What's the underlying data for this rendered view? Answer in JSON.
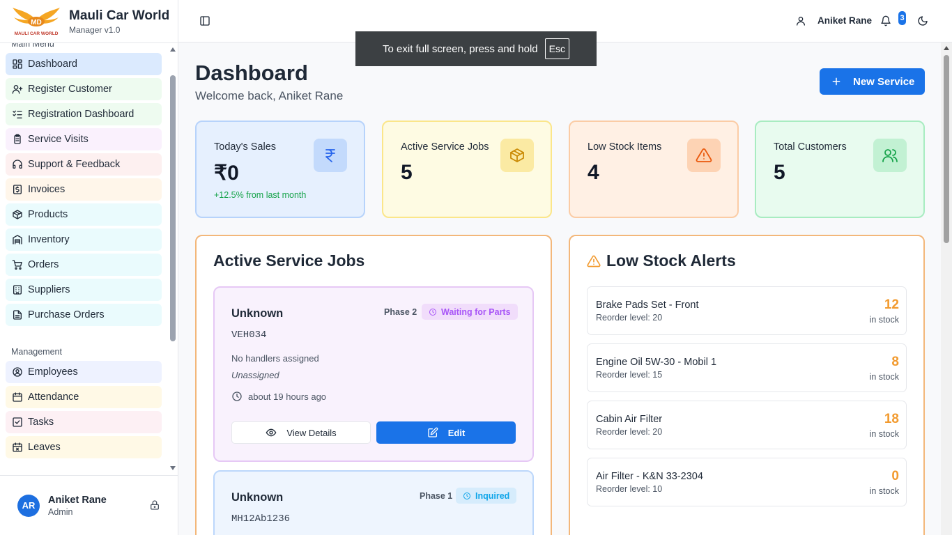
{
  "app": {
    "name": "Mauli Car World",
    "version": "Manager v1.0",
    "logo_text": "MAULI CAR WORLD"
  },
  "sidebar": {
    "main_menu_label": "Main Menu",
    "main_items": [
      {
        "label": "Dashboard",
        "icon": "layout-dashboard-icon",
        "bg": "#dbeafe",
        "active": true
      },
      {
        "label": "Register Customer",
        "icon": "user-plus-icon",
        "bg": "#eefbf0"
      },
      {
        "label": "Registration Dashboard",
        "icon": "list-checks-icon",
        "bg": "#eefbf0"
      },
      {
        "label": "Service Visits",
        "icon": "clipboard-icon",
        "bg": "#faf1fd"
      },
      {
        "label": "Support & Feedback",
        "icon": "headphones-icon",
        "bg": "#fdf0f0"
      },
      {
        "label": "Invoices",
        "icon": "receipt-icon",
        "bg": "#fff6ea"
      },
      {
        "label": "Products",
        "icon": "package-icon",
        "bg": "#eafbfd"
      },
      {
        "label": "Inventory",
        "icon": "warehouse-icon",
        "bg": "#eafbfd"
      },
      {
        "label": "Orders",
        "icon": "cart-icon",
        "bg": "#eafbfd"
      },
      {
        "label": "Suppliers",
        "icon": "building-icon",
        "bg": "#eafbfd"
      },
      {
        "label": "Purchase Orders",
        "icon": "file-icon",
        "bg": "#eafbfd"
      }
    ],
    "management_label": "Management",
    "management_items": [
      {
        "label": "Employees",
        "icon": "user-circle-icon",
        "bg": "#eef2ff"
      },
      {
        "label": "Attendance",
        "icon": "calendar-icon",
        "bg": "#fff9e6"
      },
      {
        "label": "Tasks",
        "icon": "check-square-icon",
        "bg": "#fdf0f4"
      },
      {
        "label": "Leaves",
        "icon": "calendar-x-icon",
        "bg": "#fff9e6"
      }
    ],
    "user": {
      "initials": "AR",
      "name": "Aniket Rane",
      "role": "Admin"
    }
  },
  "topbar": {
    "user_name": "Aniket Rane",
    "notification_count": "3"
  },
  "fullscreen_toast": {
    "text": "To exit full screen, press and hold",
    "key": "Esc"
  },
  "page": {
    "title": "Dashboard",
    "welcome": "Welcome back, Aniket Rane",
    "new_button": "New Service"
  },
  "stats": [
    {
      "label": "Today's Sales",
      "value": "₹0",
      "note": "+12.5% from last month",
      "icon": "rupee-icon",
      "bg": "#e6f0fe",
      "border": "#b7d3fb",
      "icon_bg": "#c3dafc",
      "icon_color": "#2563eb"
    },
    {
      "label": "Active Service Jobs",
      "value": "5",
      "note": "",
      "icon": "package-icon",
      "bg": "#fefbe3",
      "border": "#fbe68a",
      "icon_bg": "#fbeaa3",
      "icon_color": "#ca8a04"
    },
    {
      "label": "Low Stock Items",
      "value": "4",
      "note": "",
      "icon": "alert-triangle-icon",
      "bg": "#fff0e4",
      "border": "#fbcca5",
      "icon_bg": "#fdd3b4",
      "icon_color": "#ea580c"
    },
    {
      "label": "Total Customers",
      "value": "5",
      "note": "",
      "icon": "users-icon",
      "bg": "#e8fbef",
      "border": "#a8ecc1",
      "icon_bg": "#c2f1d3",
      "icon_color": "#16a34a"
    }
  ],
  "active_jobs": {
    "title": "Active Service Jobs",
    "jobs": [
      {
        "name": "Unknown",
        "phase": "Phase 2",
        "status": "Waiting for Parts",
        "vehicle": "VEH034",
        "handlers": "No handlers assigned",
        "assignee": "Unassigned",
        "time": "about 19 hours ago",
        "view_label": "View Details",
        "edit_label": "Edit",
        "bg": "#f9f2fd",
        "border": "#e6c8f5",
        "pill_bg": "#f1ddfb",
        "pill_color": "#a855f7"
      },
      {
        "name": "Unknown",
        "phase": "Phase 1",
        "status": "Inquired",
        "vehicle": "MH12Ab1236",
        "handlers": "",
        "assignee": "",
        "time": "",
        "view_label": "",
        "edit_label": "",
        "bg": "#eef5fe",
        "border": "#bcd7fb",
        "pill_bg": "#d6ecfc",
        "pill_color": "#0ea5e9"
      }
    ]
  },
  "low_stock": {
    "title": "Low Stock Alerts",
    "items": [
      {
        "name": "Brake Pads Set - Front",
        "reorder": "Reorder level: 20",
        "qty": "12",
        "unit": "in stock"
      },
      {
        "name": "Engine Oil 5W-30 - Mobil 1",
        "reorder": "Reorder level: 15",
        "qty": "8",
        "unit": "in stock"
      },
      {
        "name": "Cabin Air Filter",
        "reorder": "Reorder level: 20",
        "qty": "18",
        "unit": "in stock"
      },
      {
        "name": "Air Filter - K&N 33-2304",
        "reorder": "Reorder level: 10",
        "qty": "0",
        "unit": "in stock"
      }
    ]
  }
}
